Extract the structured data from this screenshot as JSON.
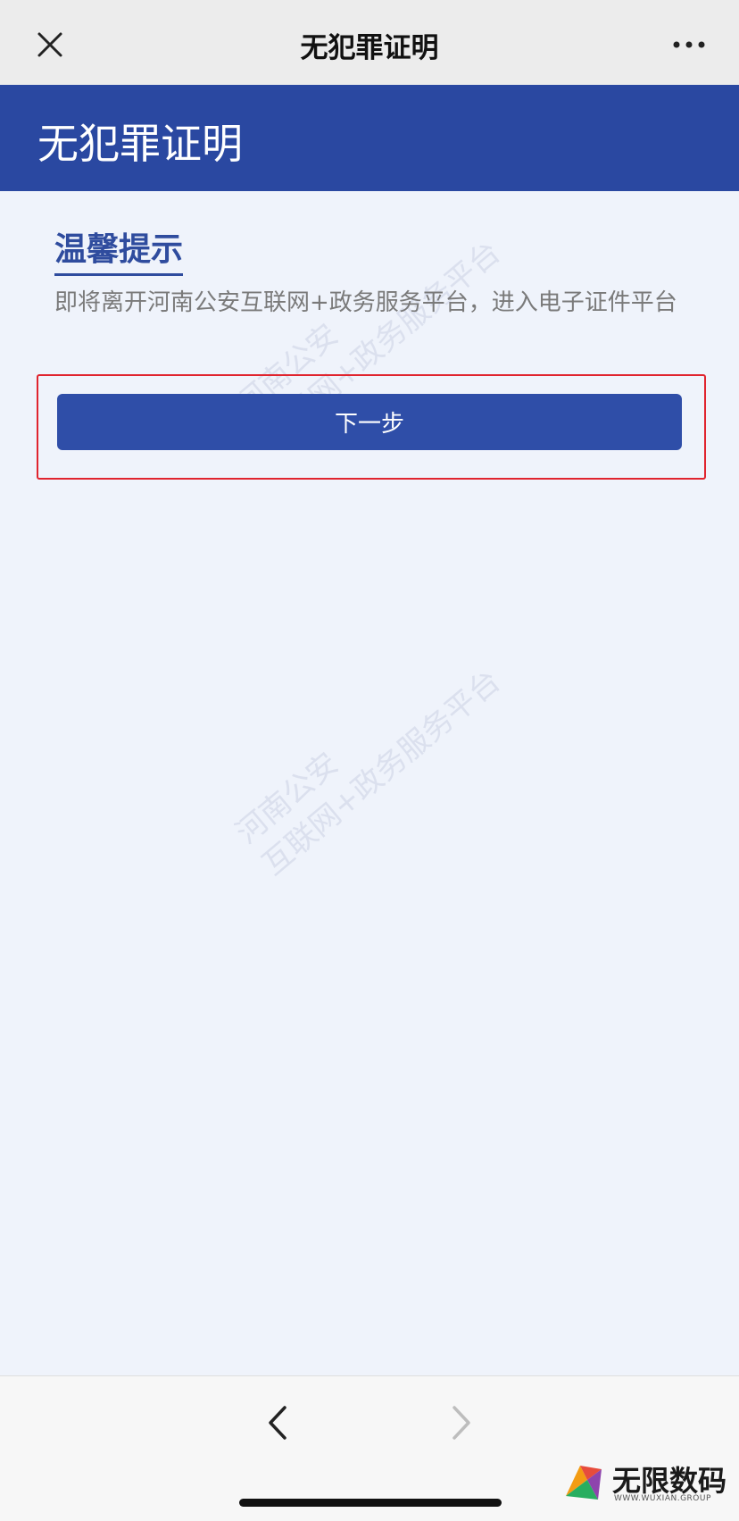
{
  "nav": {
    "title": "无犯罪证明",
    "close_icon": "close-icon",
    "more_icon": "more-icon"
  },
  "banner": {
    "title": "无犯罪证明"
  },
  "tip": {
    "title": "温馨提示",
    "text": "即将离开河南公安互联网+政务服务平台，进入电子证件平台"
  },
  "actions": {
    "next_label": "下一步"
  },
  "watermark": {
    "line1": "河南公安",
    "line2": "互联网+政务服务平台"
  },
  "bottom": {
    "back_icon": "chevron-left-icon",
    "forward_icon": "chevron-right-icon"
  },
  "brand": {
    "name": "无限数码",
    "sub": "WWW.WUXIAN.GROUP"
  },
  "colors": {
    "accent": "#2a48a1",
    "button": "#2f4ea8",
    "highlight": "#e0242e",
    "background": "#eff3fb"
  }
}
